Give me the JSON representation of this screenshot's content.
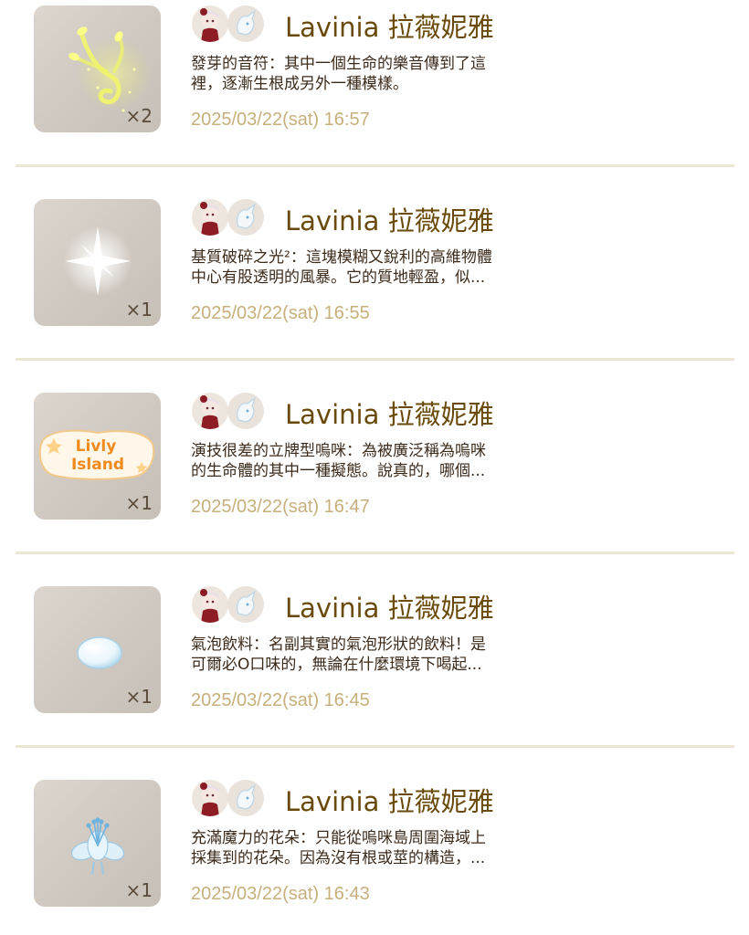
{
  "entries": [
    {
      "item": "glowing-sprout-notes",
      "quantity": "×2",
      "name": "Lavinia 拉薇妮雅",
      "desc_line1": "發芽的音符：其中一個生命的樂音傳到了這",
      "desc_line2": "裡，逐漸生根成另外一種模樣。",
      "time": "2025/03/22(sat) 16:57"
    },
    {
      "item": "white-sparkle-light",
      "quantity": "×1",
      "name": "Lavinia 拉薇妮雅",
      "desc_line1": "基質破碎之光²：這塊模糊又銳利的高維物體",
      "desc_line2": "中心有股透明的風暴。它的質地輕盈，似...",
      "time": "2025/03/22(sat) 16:55"
    },
    {
      "item": "livly-island-sign",
      "sign_line1": "Livly",
      "sign_line2": "Island",
      "quantity": "×1",
      "name": "Lavinia 拉薇妮雅",
      "desc_line1": "演技很差的立牌型嗚咪：為被廣泛稱為嗚咪",
      "desc_line2": "的生命體的其中一種擬態。說真的，哪個...",
      "time": "2025/03/22(sat) 16:47"
    },
    {
      "item": "bubble-drink",
      "quantity": "×1",
      "name": "Lavinia 拉薇妮雅",
      "desc_line1": "氣泡飲料：名副其實的氣泡形狀的飲料！是",
      "desc_line2": "可爾必O口味的，無論在什麼環境下喝起...",
      "time": "2025/03/22(sat) 16:45"
    },
    {
      "item": "blue-magic-flower",
      "quantity": "×1",
      "name": "Lavinia 拉薇妮雅",
      "desc_line1": "充滿魔力的花朵：只能從嗚咪島周圍海域上",
      "desc_line2": "採集到的花朵。因為沒有根或莖的構造，...",
      "time": "2025/03/22(sat) 16:43"
    }
  ]
}
